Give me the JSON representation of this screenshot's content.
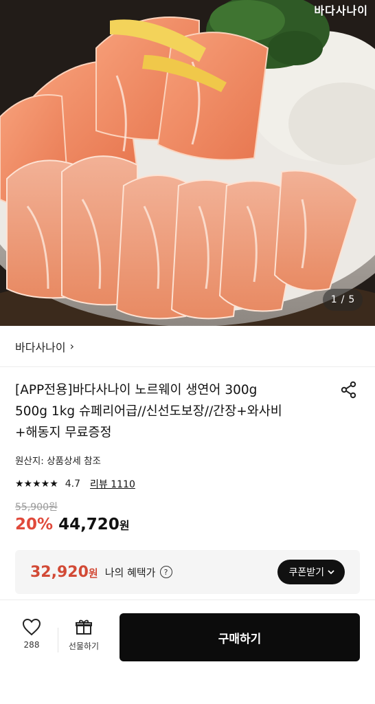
{
  "hero": {
    "watermark": "바다사나이",
    "pager_current": "1",
    "pager_sep": "/",
    "pager_total": "5"
  },
  "brand": {
    "name": "바다사나이",
    "chevron": "›"
  },
  "product": {
    "title_line1": "[APP전용]바다사나이 노르웨이 생연어 300g",
    "title_line2": "500g 1kg 슈페리어급//신선도보장//간장+와사비",
    "title_line3": "+해동지 무료증정",
    "origin": "원산지: 상품상세 참조",
    "rating_value": "4.7",
    "stars": "★★★★★",
    "review_label": "리뷰 1110",
    "original_price": "55,900원",
    "discount": "20%",
    "price": "44,720",
    "price_unit": "원"
  },
  "benefit": {
    "price": "32,920",
    "price_unit": "원",
    "label": "나의 혜택가",
    "help": "?",
    "coupon_label": "쿠폰받기",
    "coupon_chevron": "⌄"
  },
  "bottom": {
    "like_count": "288",
    "gift_label": "선물하기",
    "buy_label": "구매하기"
  },
  "colors": {
    "discount": "#e0493a",
    "benefit_price": "#d24a36",
    "buy_button": "#0c0c0c",
    "benefit_bg": "#f5f5f5"
  },
  "icons": {
    "share": "share-icon",
    "heart": "heart-icon",
    "gift": "gift-icon",
    "help": "help-icon"
  }
}
